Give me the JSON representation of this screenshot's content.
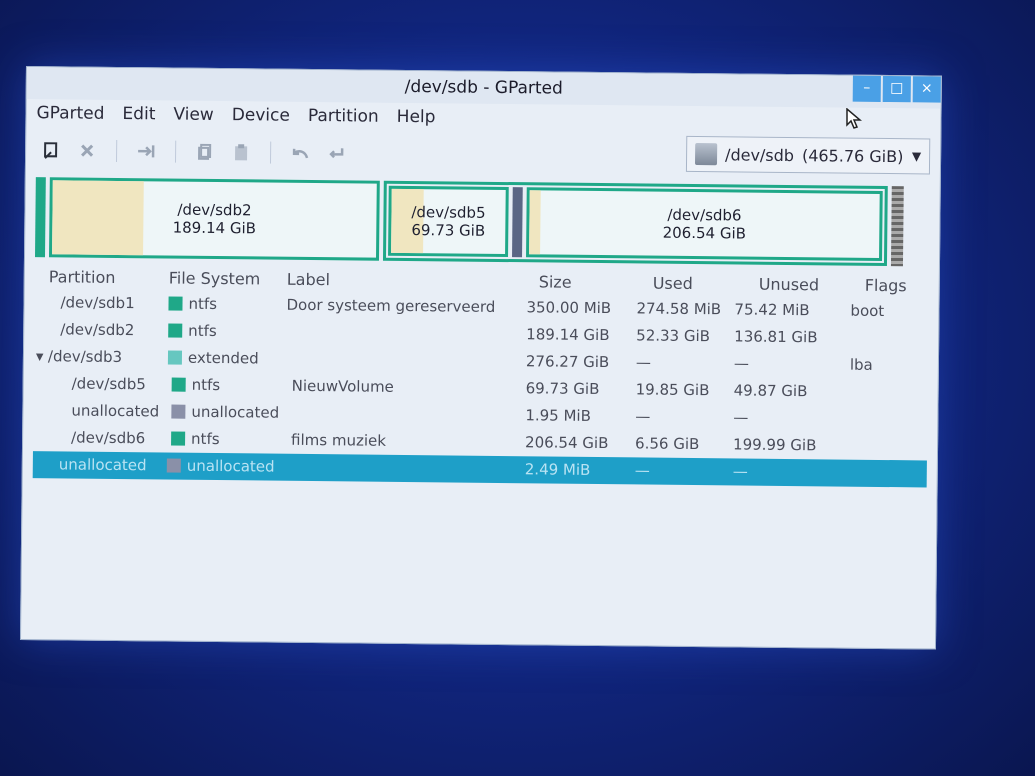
{
  "window": {
    "title": "/dev/sdb - GParted",
    "buttons": [
      "–",
      "□",
      "×"
    ]
  },
  "menu": [
    "GParted",
    "Edit",
    "View",
    "Device",
    "Partition",
    "Help"
  ],
  "toolbar": {
    "icons": [
      "new-icon",
      "delete-icon",
      "resize-icon",
      "copy-icon",
      "paste-icon",
      "undo-icon",
      "apply-icon"
    ]
  },
  "device_selector": {
    "device": "/dev/sdb",
    "size": "(465.76 GiB)"
  },
  "disk_map": {
    "sdb2": {
      "name": "/dev/sdb2",
      "size": "189.14 GiB",
      "used_fraction": 0.28
    },
    "sdb5": {
      "name": "/dev/sdb5",
      "size": "69.73 GiB",
      "used_fraction": 0.28
    },
    "sdb6": {
      "name": "/dev/sdb6",
      "size": "206.54 GiB",
      "used_fraction": 0.03
    }
  },
  "columns": [
    "Partition",
    "File System",
    "Label",
    "Size",
    "Used",
    "Unused",
    "Flags"
  ],
  "colors": {
    "ntfs": "#1fa888",
    "extended": "#66c7c0",
    "unallocated": "#8a90a8",
    "selection": "#1e9fc8"
  },
  "rows": [
    {
      "partition": "/dev/sdb1",
      "fs": "ntfs",
      "fs_color": "#1fa888",
      "label": "Door systeem gereserveerd",
      "size": "350.00 MiB",
      "used": "274.58 MiB",
      "unused": "75.42 MiB",
      "flags": "boot",
      "indent": 1
    },
    {
      "partition": "/dev/sdb2",
      "fs": "ntfs",
      "fs_color": "#1fa888",
      "label": "",
      "size": "189.14 GiB",
      "used": "52.33 GiB",
      "unused": "136.81 GiB",
      "flags": "",
      "indent": 1
    },
    {
      "partition": "/dev/sdb3",
      "fs": "extended",
      "fs_color": "#66c7c0",
      "label": "",
      "size": "276.27 GiB",
      "used": "—",
      "unused": "—",
      "flags": "lba",
      "indent": 0,
      "expander": "▾"
    },
    {
      "partition": "/dev/sdb5",
      "fs": "ntfs",
      "fs_color": "#1fa888",
      "label": "NieuwVolume",
      "size": "69.73 GiB",
      "used": "19.85 GiB",
      "unused": "49.87 GiB",
      "flags": "",
      "indent": 2
    },
    {
      "partition": "unallocated",
      "fs": "unallocated",
      "fs_color": "#8a90a8",
      "label": "",
      "size": "1.95 MiB",
      "used": "—",
      "unused": "—",
      "flags": "",
      "indent": 2
    },
    {
      "partition": "/dev/sdb6",
      "fs": "ntfs",
      "fs_color": "#1fa888",
      "label": "films muziek",
      "size": "206.54 GiB",
      "used": "6.56 GiB",
      "unused": "199.99 GiB",
      "flags": "",
      "indent": 2
    },
    {
      "partition": "unallocated",
      "fs": "unallocated",
      "fs_color": "#8a90a8",
      "label": "",
      "size": "2.49 MiB",
      "used": "—",
      "unused": "—",
      "flags": "",
      "indent": 1,
      "selected": true
    }
  ]
}
